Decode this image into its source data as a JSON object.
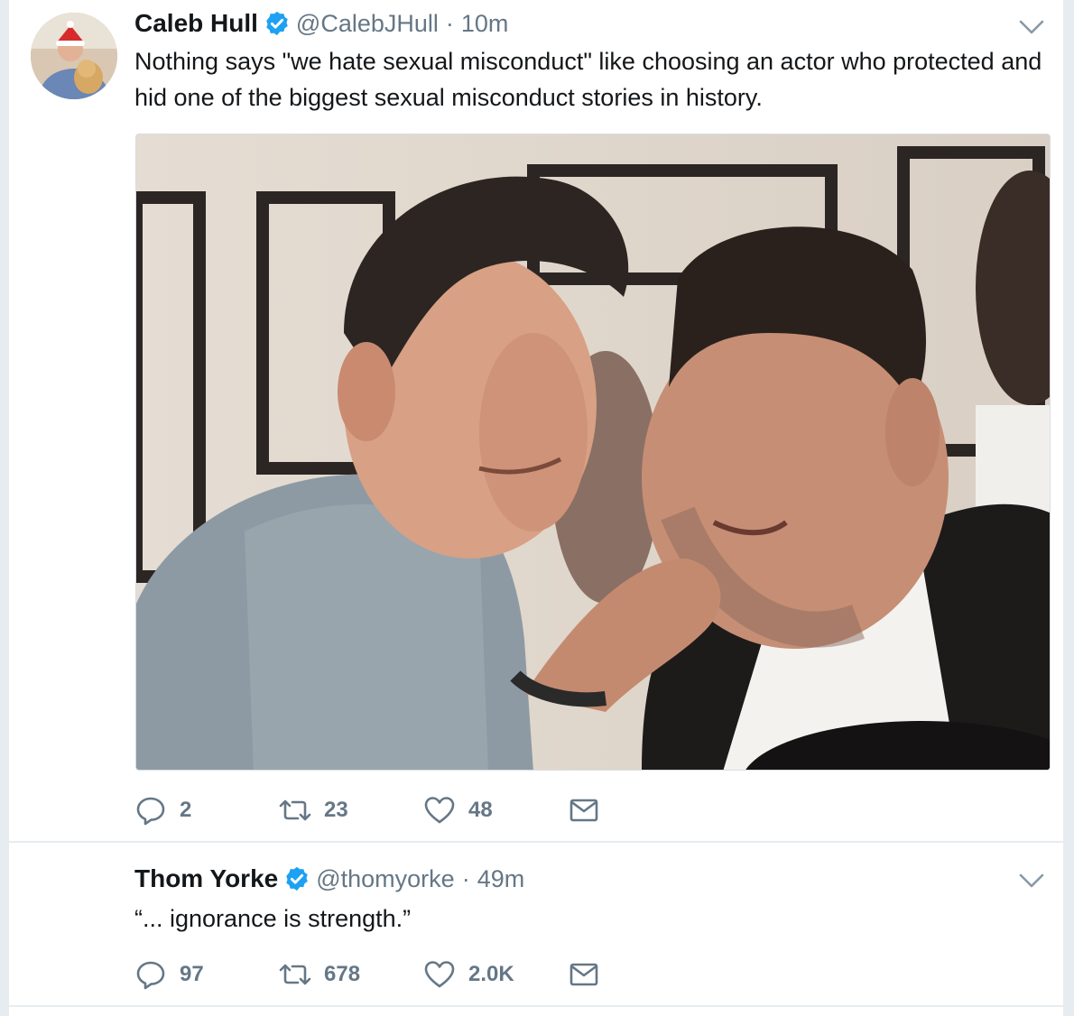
{
  "tweets": [
    {
      "name": "Caleb Hull",
      "handle": "@CalebJHull",
      "separator": "·",
      "time": "10m",
      "text": "Nothing says \"we hate sexual misconduct\" like choosing an actor who protected and hid one of the biggest sexual misconduct stories in history.",
      "counts": {
        "replies": "2",
        "retweets": "23",
        "likes": "48"
      }
    },
    {
      "name": "Thom Yorke",
      "handle": "@thomyorke",
      "separator": "·",
      "time": "49m",
      "text": "“... ignorance is strength.”",
      "counts": {
        "replies": "97",
        "retweets": "678",
        "likes": "2.0K"
      }
    }
  ],
  "icons": {
    "verified": "verified-badge-icon",
    "caret": "chevron-down-icon",
    "reply": "reply-icon",
    "retweet": "retweet-icon",
    "like": "heart-icon",
    "message": "envelope-icon"
  },
  "colors": {
    "verified_blue": "#1da1f2",
    "secondary_text": "#657786",
    "divider": "#e6ecf0",
    "page_background": "#e6ecf0"
  }
}
